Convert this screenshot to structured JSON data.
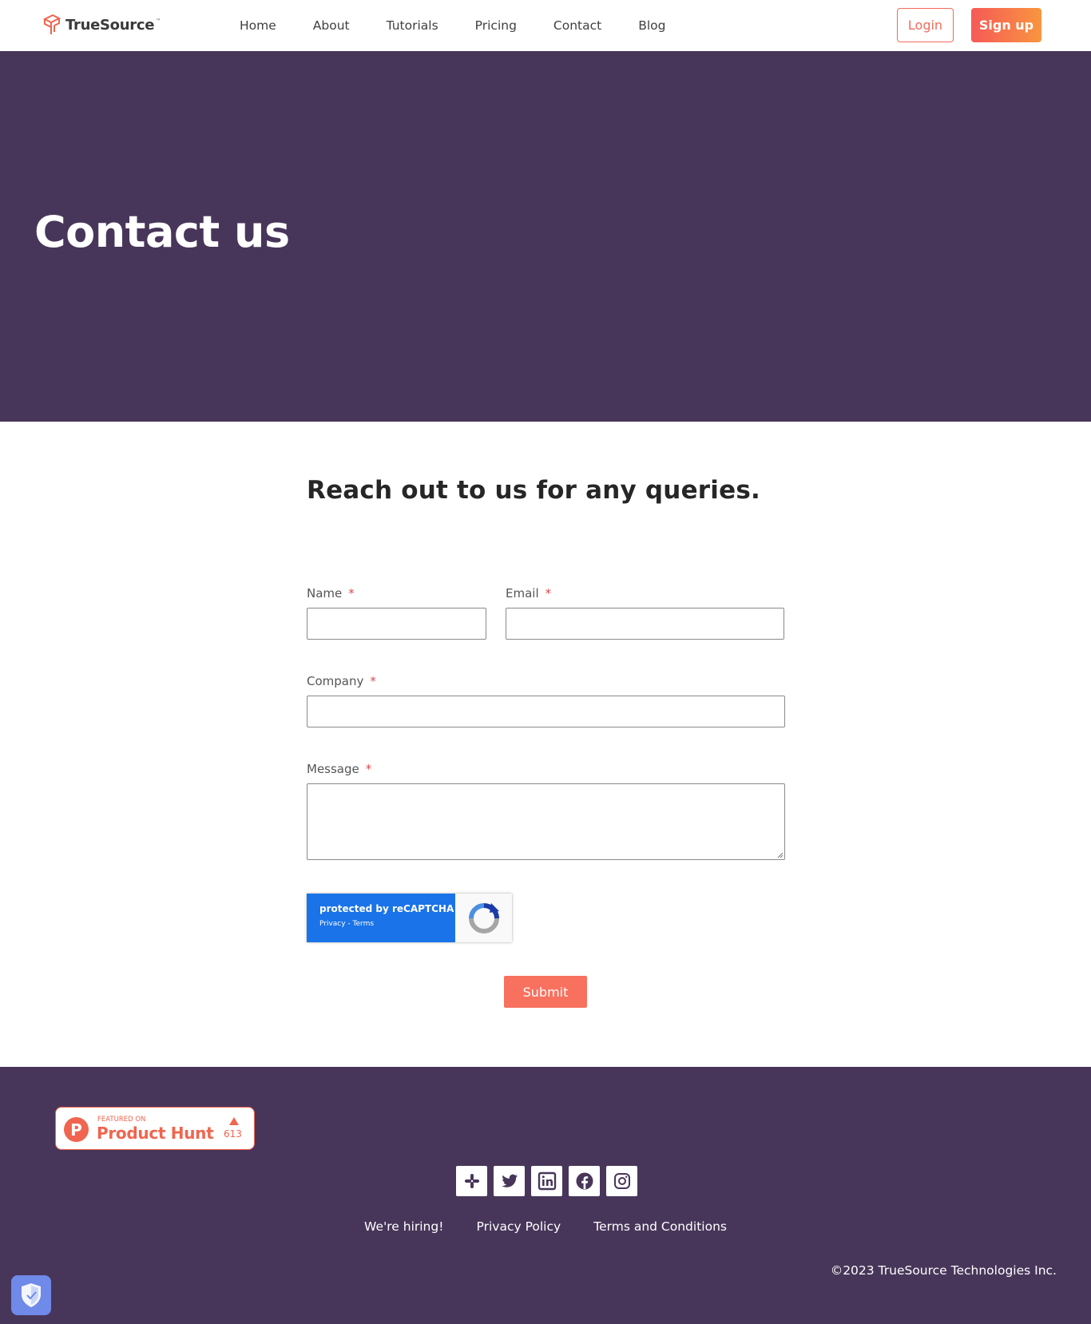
{
  "header": {
    "logo_text": "TrueSource",
    "logo_tm": "™",
    "nav": [
      "Home",
      "About",
      "Tutorials",
      "Pricing",
      "Contact",
      "Blog"
    ],
    "login_label": "Login",
    "signup_label": "Sign up"
  },
  "hero": {
    "title": "Contact us"
  },
  "form": {
    "heading": "Reach out to us for any queries.",
    "name_label": "Name",
    "email_label": "Email",
    "company_label": "Company",
    "message_label": "Message",
    "required_mark": "*",
    "name_value": "",
    "email_value": "",
    "company_value": "",
    "message_value": "",
    "recaptcha_title": "protected by reCAPTCHA",
    "recaptcha_links": "Privacy - Terms",
    "submit_label": "Submit"
  },
  "footer": {
    "producthunt_small": "FEATURED ON",
    "producthunt_big": "Product Hunt",
    "producthunt_count": "613",
    "producthunt_letter": "P",
    "socials": [
      "slack-icon",
      "twitter-icon",
      "linkedin-icon",
      "facebook-icon",
      "instagram-icon"
    ],
    "links": [
      "We're hiring!",
      "Privacy Policy",
      "Terms and Conditions"
    ],
    "copyright": "©2023 TrueSource Technologies Inc."
  },
  "colors": {
    "brand_purple": "#48365a",
    "accent_coral": "#f26b5a",
    "recaptcha_blue": "#1a73e8"
  }
}
